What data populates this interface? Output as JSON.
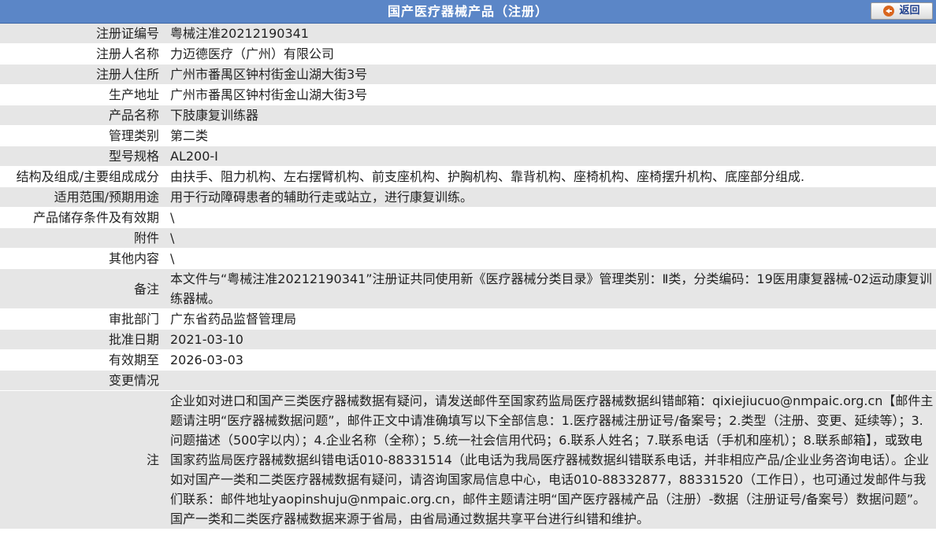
{
  "header": {
    "title": "国产医疗器械产品（注册）",
    "back_label": "返回"
  },
  "rows": [
    {
      "label": "注册证编号",
      "value": "粤械注准20212190341"
    },
    {
      "label": "注册人名称",
      "value": "力迈德医疗（广州）有限公司"
    },
    {
      "label": "注册人住所",
      "value": "广州市番禺区钟村街金山湖大街3号"
    },
    {
      "label": "生产地址",
      "value": "广州市番禺区钟村街金山湖大街3号"
    },
    {
      "label": "产品名称",
      "value": "下肢康复训练器"
    },
    {
      "label": "管理类别",
      "value": "第二类"
    },
    {
      "label": "型号规格",
      "value": "AL200-Ⅰ"
    },
    {
      "label": "结构及组成/主要组成成分",
      "value": "由扶手、阻力机构、左右摆臂机构、前支座机构、护胸机构、靠背机构、座椅机构、座椅摆升机构、底座部分组成."
    },
    {
      "label": "适用范围/预期用途",
      "value": "用于行动障碍患者的辅助行走或站立，进行康复训练。"
    },
    {
      "label": "产品储存条件及有效期",
      "value": "\\"
    },
    {
      "label": "附件",
      "value": "\\"
    },
    {
      "label": "其他内容",
      "value": "\\"
    },
    {
      "label": "备注",
      "value": "本文件与“粤械注准20212190341”注册证共同使用新《医疗器械分类目录》管理类别：Ⅱ类，分类编码：19医用康复器械-02运动康复训练器械。"
    },
    {
      "label": "审批部门",
      "value": "广东省药品监督管理局"
    },
    {
      "label": "批准日期",
      "value": "2021-03-10"
    },
    {
      "label": "有效期至",
      "value": "2026-03-03"
    },
    {
      "label": "变更情况",
      "value": ""
    }
  ],
  "notice": {
    "label": "注",
    "text": "企业如对进口和国产三类医疗器械数据有疑问，请发送邮件至国家药监局医疗器械数据纠错邮箱：qixiejiucuo@nmpaic.org.cn【邮件主题请注明“医疗器械数据问题”，邮件正文中请准确填写以下全部信息：1.医疗器械注册证号/备案号；2.类型（注册、变更、延续等）；3.问题描述（500字以内）；4.企业名称（全称）；5.统一社会信用代码；6.联系人姓名；7.联系电话（手机和座机）；8.联系邮箱】，或致电国家药监局医疗器械数据纠错电话010-88331514（此电话为我局医疗器械数据纠错联系电话，并非相应产品/企业业务咨询电话）。企业如对国产一类和二类医疗器械数据有疑问，请咨询国家局信息中心，电话010-88332877，88331520（工作日），也可通过发邮件与我们联系：邮件地址yaopinshuju@nmpaic.org.cn，邮件主题请注明“国产医疗器械产品（注册）-数据（注册证号/备案号）数据问题”。国产一类和二类医疗器械数据来源于省局，由省局通过数据共享平台进行纠错和维护。"
  }
}
